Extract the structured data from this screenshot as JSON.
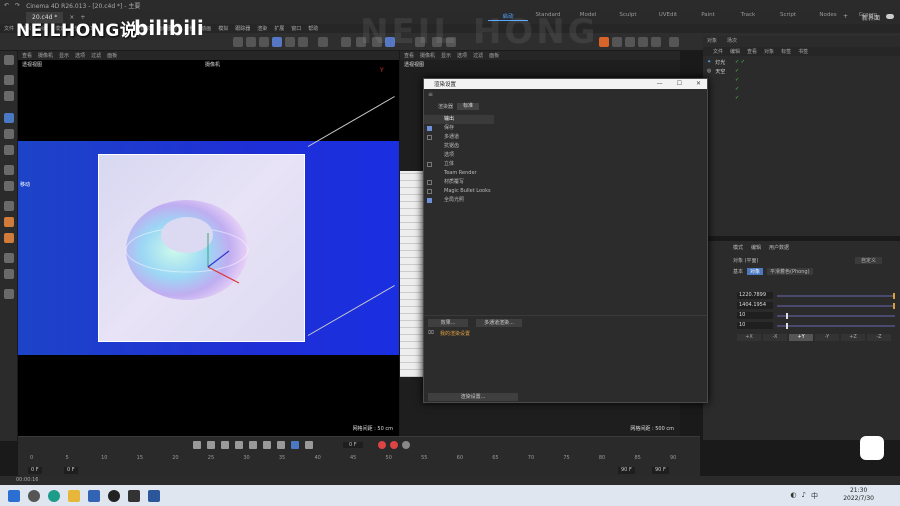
{
  "app": {
    "window_title": "Cinema 4D R26.013 - [20.c4d *] - 主要",
    "doc_tab": "20.c4d *",
    "layout_tabs": [
      {
        "label": "启动",
        "active": true
      },
      {
        "label": "Standard",
        "active": false
      },
      {
        "label": "Model",
        "active": false
      },
      {
        "label": "Sculpt",
        "active": false
      },
      {
        "label": "UVEdit",
        "active": false
      },
      {
        "label": "Paint",
        "active": false
      },
      {
        "label": "Track",
        "active": false
      },
      {
        "label": "Script",
        "active": false
      },
      {
        "label": "Nodes",
        "active": false
      },
      {
        "label": "Groom",
        "active": false
      }
    ],
    "new_layout_label": "新界面",
    "watermark": "NEILHONG说",
    "watermark_logo": "bilibili",
    "big_watermark": "NEIL HONG"
  },
  "menubar": [
    "文件",
    "编辑",
    "创建",
    "模式",
    "选择",
    "工具",
    "样条",
    "网格",
    "体积",
    "运动图形",
    "角色",
    "动画",
    "模拟",
    "跟踪器",
    "渲染",
    "扩展",
    "窗口",
    "帮助"
  ],
  "viewport_left": {
    "menu": [
      "查看",
      "摄像机",
      "显示",
      "选项",
      "过滤",
      "面板"
    ],
    "title": "透视视图",
    "camera": "摄像机",
    "move_label": "移动",
    "footer": "网格间距 : 50 cm"
  },
  "viewport_right": {
    "menu": [
      "查看",
      "摄像机",
      "显示",
      "选项",
      "过滤",
      "面板"
    ],
    "title": "透视视图",
    "footer": "网格间距 : 500 cm"
  },
  "render_dialog": {
    "title": "渲染设置",
    "renderer_label": "渲染器",
    "renderer_value": "标准",
    "items": [
      {
        "label": "输出",
        "checkbox": false,
        "checked": false,
        "selected": true
      },
      {
        "label": "保存",
        "checkbox": true,
        "checked": true,
        "selected": false
      },
      {
        "label": "多通道",
        "checkbox": true,
        "checked": false,
        "selected": false
      },
      {
        "label": "抗锯齿",
        "checkbox": false,
        "checked": false,
        "selected": false
      },
      {
        "label": "选项",
        "checkbox": false,
        "checked": false,
        "selected": false
      },
      {
        "label": "立体",
        "checkbox": true,
        "checked": false,
        "selected": false
      },
      {
        "label": "Team Render",
        "checkbox": false,
        "checked": false,
        "selected": false
      },
      {
        "label": "材质覆写",
        "checkbox": true,
        "checked": false,
        "selected": false
      },
      {
        "label": "Magic Bullet Looks",
        "checkbox": true,
        "checked": false,
        "selected": false
      },
      {
        "label": "全局光照",
        "checkbox": true,
        "checked": true,
        "selected": false
      }
    ],
    "effects_button": "效果...",
    "multipass_button": "多通道渲染...",
    "preset_label": "我的渲染设置",
    "render_settings_button": "渲染设置..."
  },
  "object_manager": {
    "tabs": [
      "对象",
      "场次"
    ],
    "menu": [
      "文件",
      "编辑",
      "查看",
      "对象",
      "标签",
      "书签"
    ],
    "rows": [
      {
        "name": "灯光",
        "color": "#58a6ff"
      },
      {
        "name": "天空",
        "color": "#dddddd"
      }
    ]
  },
  "attribute_manager": {
    "tabs": [
      "模式",
      "编辑",
      "用户数据"
    ],
    "object_type": "对象 (平面)",
    "custom_label": "自定义",
    "subtabs": [
      "基本",
      "坐标",
      "对象",
      "平滑着色(Phong)"
    ],
    "fields": [
      {
        "value": "1220.7899",
        "fraction": 1.0
      },
      {
        "value": "1404.1954",
        "fraction": 1.0
      },
      {
        "value": "10",
        "fraction": 0.08
      },
      {
        "value": "10",
        "fraction": 0.08
      }
    ],
    "axis_buttons": [
      {
        "label": "+X",
        "active": false
      },
      {
        "label": "-X",
        "active": false
      },
      {
        "label": "+Y",
        "active": true
      },
      {
        "label": "-Y",
        "active": false
      },
      {
        "label": "+Z",
        "active": false
      },
      {
        "label": "-Z",
        "active": false
      }
    ]
  },
  "timeline": {
    "current_frame": "0 F",
    "ticks": [
      "0",
      "5",
      "10",
      "15",
      "20",
      "25",
      "30",
      "35",
      "40",
      "45",
      "50",
      "55",
      "60",
      "65",
      "70",
      "75",
      "80",
      "85",
      "90"
    ],
    "start_frame": "0 F",
    "start_frame2": "0 F",
    "end_frame": "90 F",
    "end_frame2": "90 F"
  },
  "statusbar": {
    "time": "00:00:16"
  },
  "taskbar": {
    "time": "21:30",
    "date": "2022/7/30",
    "tray_text": "中"
  }
}
